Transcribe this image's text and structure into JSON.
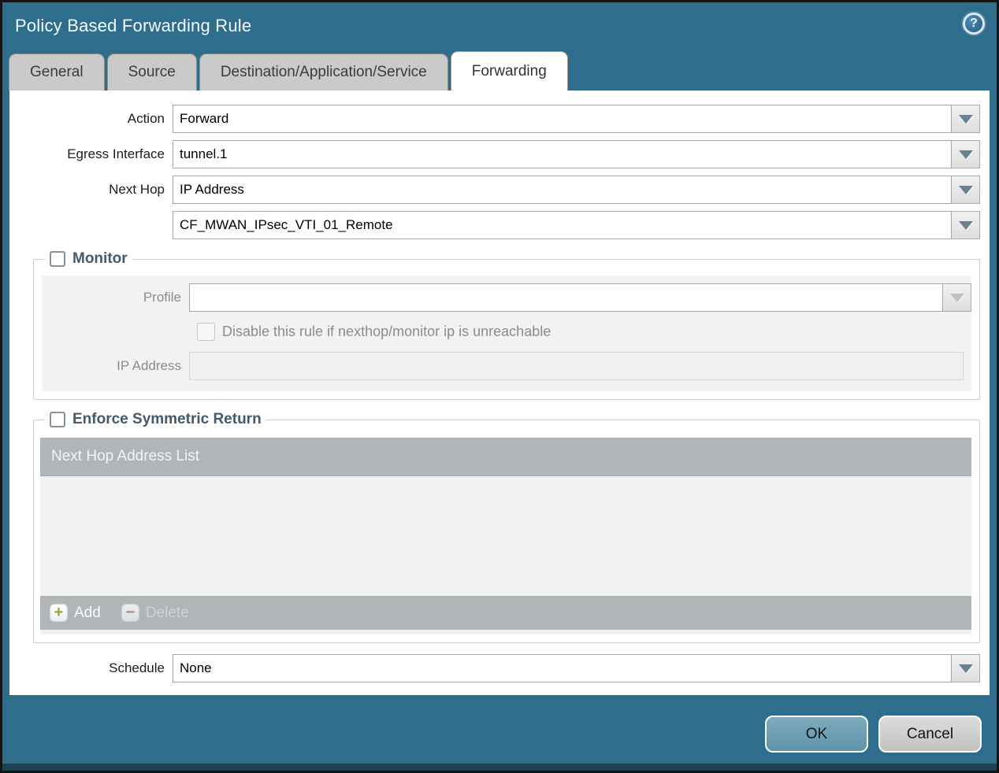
{
  "window": {
    "title": "Policy Based Forwarding Rule"
  },
  "icons": {
    "help_glyph": "?",
    "add_glyph": "+",
    "delete_glyph": "−"
  },
  "tabs": [
    {
      "label": "General",
      "active": false
    },
    {
      "label": "Source",
      "active": false
    },
    {
      "label": "Destination/Application/Service",
      "active": false
    },
    {
      "label": "Forwarding",
      "active": true
    }
  ],
  "form": {
    "action": {
      "label": "Action",
      "value": "Forward"
    },
    "egress_interface": {
      "label": "Egress Interface",
      "value": "tunnel.1"
    },
    "next_hop": {
      "label": "Next Hop",
      "value": "IP Address"
    },
    "next_hop_address": {
      "value": "CF_MWAN_IPsec_VTI_01_Remote"
    },
    "schedule": {
      "label": "Schedule",
      "value": "None"
    }
  },
  "monitor": {
    "title": "Monitor",
    "checked": false,
    "profile": {
      "label": "Profile",
      "value": ""
    },
    "disable_rule": {
      "label": "Disable this rule if nexthop/monitor ip is unreachable",
      "checked": false
    },
    "ip_address": {
      "label": "IP Address",
      "value": ""
    }
  },
  "enforce_symmetric_return": {
    "title": "Enforce Symmetric Return",
    "checked": false,
    "list": {
      "header": "Next Hop Address List",
      "rows": [],
      "add_label": "Add",
      "delete_label": "Delete"
    }
  },
  "footer": {
    "ok_label": "OK",
    "cancel_label": "Cancel"
  },
  "colors": {
    "titlebar": "#2e6d8b",
    "footer_strip": "#1b4354",
    "tab_inactive": "#cacaca",
    "section_title": "#44596b",
    "list_header_bg": "#b1b5b8",
    "profile_field_bg": "#f6efdb",
    "ok_button": "#6c9fb4",
    "cancel_button": "#cccccc",
    "add_icon_green": "#91a839",
    "delete_icon_red": "#b07a6e"
  }
}
